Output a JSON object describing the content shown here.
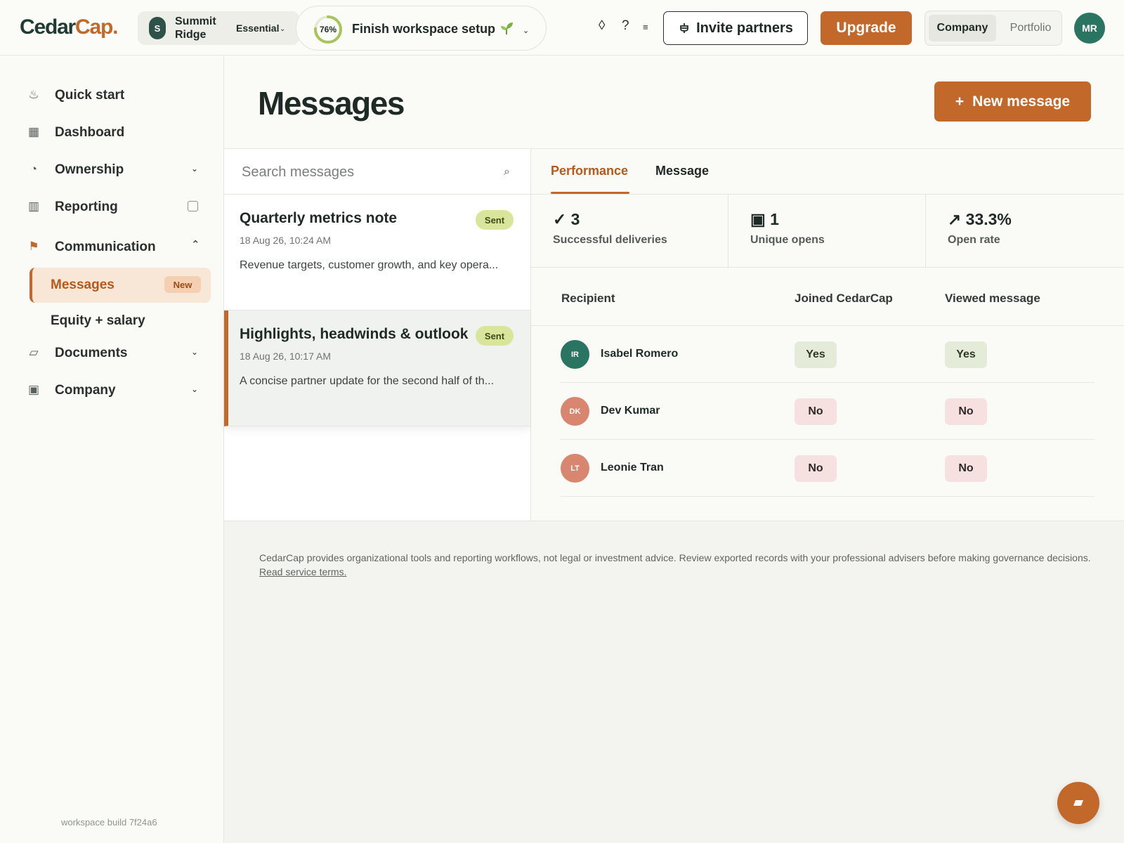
{
  "app": {
    "logo_main": "Cedar",
    "logo_accent": "Cap",
    "logo_dot": "."
  },
  "workspace": {
    "avatar_letter": "S",
    "name": "Summit Ridge",
    "plan": "Essential"
  },
  "setup": {
    "progress": 0.76,
    "progress_label": "76%",
    "label": "Finish workspace setup"
  },
  "topbar": {
    "icons": [
      "diamond-icon",
      "help-icon",
      "menu-icon"
    ],
    "invite_label": "Invite partners",
    "upgrade_label": "Upgrade",
    "segments": [
      "Company",
      "Portfolio"
    ],
    "active_segment": "Company",
    "avatar_initials": "MR"
  },
  "sidebar": {
    "items": [
      {
        "label": "Quick start",
        "icon": "steam-icon"
      },
      {
        "label": "Dashboard",
        "icon": "grid-icon"
      },
      {
        "label": "Ownership",
        "icon": "pie-icon",
        "expandable": true
      },
      {
        "label": "Reporting",
        "icon": "bars-icon"
      },
      {
        "label": "Communication",
        "icon": "flag-icon",
        "expanded": true
      },
      {
        "label": "Documents",
        "icon": "folder-icon",
        "expandable": true
      },
      {
        "label": "Company",
        "icon": "building-icon",
        "expandable": true
      }
    ],
    "sub_items": [
      {
        "label": "Messages",
        "badge": "New",
        "active": true
      },
      {
        "label": "Equity + salary"
      }
    ],
    "build_text": "workspace build 7f24a6"
  },
  "main": {
    "title": "Messages",
    "new_button": "New message",
    "new_button_icon": "+",
    "search_placeholder": "Search messages",
    "messages": [
      {
        "title": "Quarterly metrics note",
        "date": "18 Aug 26, 10:24 AM",
        "snippet": "Revenue targets, customer growth, and key opera...",
        "status": "Sent"
      },
      {
        "title": "Highlights, headwinds & outlook",
        "date": "18 Aug 26, 10:17 AM",
        "snippet": "A concise partner update for the second half of th...",
        "status": "Sent",
        "active": true
      }
    ],
    "tabs": [
      "Performance",
      "Message"
    ],
    "active_tab": "Performance",
    "stats": [
      {
        "icon": "✓",
        "value": "3",
        "label": "Successful deliveries"
      },
      {
        "icon": "▣",
        "value": "1",
        "label": "Unique opens"
      },
      {
        "icon": "↗",
        "value": "33.3%",
        "label": "Open rate"
      }
    ],
    "table": {
      "headers": [
        "Recipient",
        "Joined CedarCap",
        "Viewed message"
      ],
      "rows": [
        {
          "initials": "IR",
          "name": "Isabel Romero",
          "joined": "Yes",
          "viewed": "Yes",
          "color": "#2a7462"
        },
        {
          "initials": "DK",
          "name": "Dev Kumar",
          "joined": "No",
          "viewed": "No",
          "color": "#d98670"
        },
        {
          "initials": "LT",
          "name": "Leonie Tran",
          "joined": "No",
          "viewed": "No",
          "color": "#d98670"
        }
      ]
    }
  },
  "footer": {
    "disclaimer": "CedarCap provides organizational tools and reporting workflows, not legal or investment advice. Review exported records with your professional advisers before making governance decisions.",
    "link": "Read service terms."
  },
  "colors": {
    "accent": "#c2682b",
    "brand": "#1f3b33",
    "sent_badge": "#d8e59a"
  }
}
